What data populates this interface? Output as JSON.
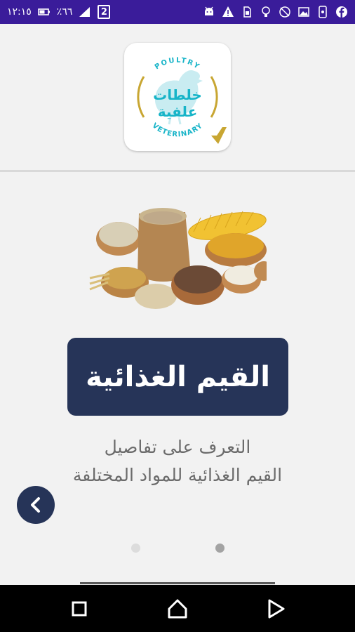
{
  "status_bar": {
    "time": "١٢:١٥",
    "battery_percent": "٪٦٦",
    "notification_badge": "2",
    "left_icons": [
      "battery-icon",
      "signal-icon",
      "notification-2-icon"
    ],
    "right_icons": [
      "android-icon",
      "warning-icon",
      "sim-icon",
      "bulb-icon",
      "no-signal-icon",
      "image-icon",
      "phone-icon",
      "facebook-icon"
    ]
  },
  "logo": {
    "top_text": "POULTRY",
    "arabic_text": "خلطات علفية",
    "bottom_text": "VETERINARY",
    "accent_color": "#17b4c8",
    "gold_color": "#c8a632"
  },
  "slide": {
    "image_alt": "grains-and-seeds-image",
    "title": "القيم الغذائية",
    "description_line1": "التعرف على تفاصيل",
    "description_line2": "القيم الغذائية للمواد المختلفة",
    "title_bg_color": "#263458"
  },
  "pager": {
    "dot_count": 2,
    "active_index": 1
  },
  "colors": {
    "status_bar": "#3a1c9a",
    "background": "#f2f2f2",
    "primary": "#263458",
    "description_text": "#6b6b6b"
  },
  "nav_bar": {
    "buttons": [
      "recents-icon",
      "home-icon",
      "back-icon"
    ]
  }
}
